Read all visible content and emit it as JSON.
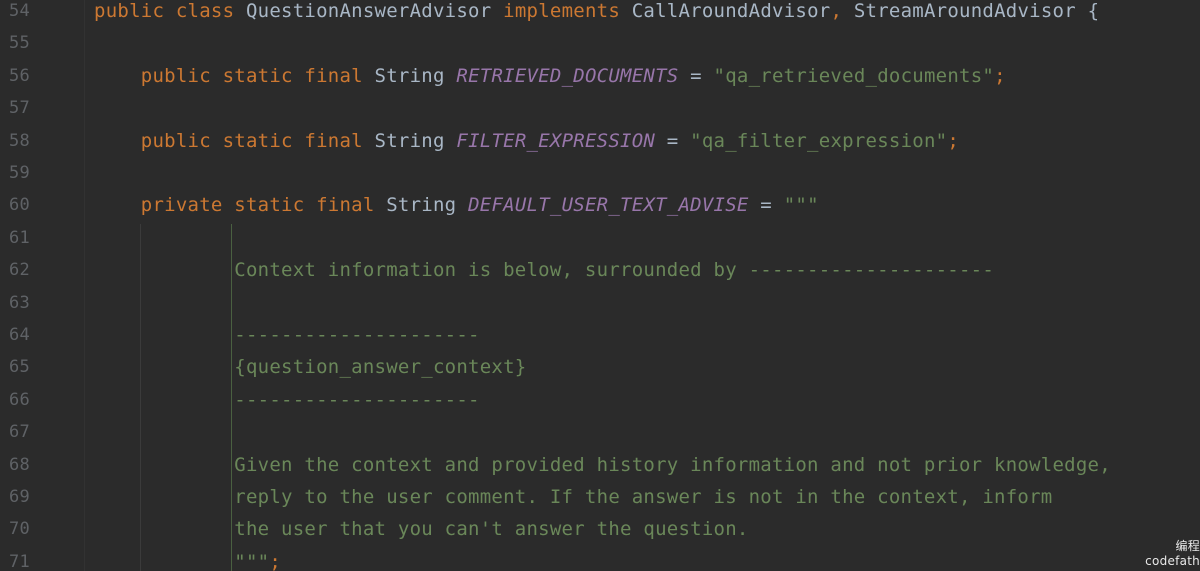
{
  "editor": {
    "lines": [
      {
        "num": "54",
        "tokens": [
          {
            "t": "kw",
            "v": "public class "
          },
          {
            "t": "plain",
            "v": "QuestionAnswerAdvisor "
          },
          {
            "t": "kw",
            "v": "implements "
          },
          {
            "t": "plain",
            "v": "CallAroundAdvisor"
          },
          {
            "t": "punc",
            "v": ", "
          },
          {
            "t": "plain",
            "v": "StreamAroundAdvisor {"
          }
        ]
      },
      {
        "num": "55",
        "tokens": []
      },
      {
        "num": "56",
        "tokens": [
          {
            "t": "kw",
            "v": "    public static final "
          },
          {
            "t": "type",
            "v": "String "
          },
          {
            "t": "const",
            "v": "RETRIEVED_DOCUMENTS"
          },
          {
            "t": "plain",
            "v": " = "
          },
          {
            "t": "str",
            "v": "\"qa_retrieved_documents\""
          },
          {
            "t": "punc",
            "v": ";"
          }
        ]
      },
      {
        "num": "57",
        "tokens": []
      },
      {
        "num": "58",
        "tokens": [
          {
            "t": "kw",
            "v": "    public static final "
          },
          {
            "t": "type",
            "v": "String "
          },
          {
            "t": "const",
            "v": "FILTER_EXPRESSION"
          },
          {
            "t": "plain",
            "v": " = "
          },
          {
            "t": "str",
            "v": "\"qa_filter_expression\""
          },
          {
            "t": "punc",
            "v": ";"
          }
        ]
      },
      {
        "num": "59",
        "tokens": []
      },
      {
        "num": "60",
        "tokens": [
          {
            "t": "kw",
            "v": "    private static final "
          },
          {
            "t": "type",
            "v": "String "
          },
          {
            "t": "const",
            "v": "DEFAULT_USER_TEXT_ADVISE"
          },
          {
            "t": "plain",
            "v": " = "
          },
          {
            "t": "str",
            "v": "\"\"\""
          }
        ]
      },
      {
        "num": "61",
        "tokens": []
      },
      {
        "num": "62",
        "tokens": [
          {
            "t": "str",
            "v": "            Context information is below, surrounded by ---------------------"
          }
        ]
      },
      {
        "num": "63",
        "tokens": []
      },
      {
        "num": "64",
        "tokens": [
          {
            "t": "str",
            "v": "            ---------------------"
          }
        ]
      },
      {
        "num": "65",
        "tokens": [
          {
            "t": "str",
            "v": "            {question_answer_context}"
          }
        ]
      },
      {
        "num": "66",
        "tokens": [
          {
            "t": "str",
            "v": "            ---------------------"
          }
        ]
      },
      {
        "num": "67",
        "tokens": []
      },
      {
        "num": "68",
        "tokens": [
          {
            "t": "str",
            "v": "            Given the context and provided history information and not prior knowledge,"
          }
        ]
      },
      {
        "num": "69",
        "tokens": [
          {
            "t": "str",
            "v": "            reply to the user comment. If the answer is not in the context, inform"
          }
        ]
      },
      {
        "num": "70",
        "tokens": [
          {
            "t": "str",
            "v": "            the user that you can't answer the question."
          }
        ]
      },
      {
        "num": "71",
        "tokens": [
          {
            "t": "str",
            "v": "            \"\"\""
          },
          {
            "t": "punc",
            "v": ";"
          }
        ]
      }
    ]
  },
  "watermark": {
    "line1": "编程",
    "line2": "codefath"
  },
  "colors": {
    "background": "#2b2b2b",
    "keyword": "#cc7832",
    "constant": "#9876aa",
    "string": "#6a8759",
    "plain": "#a9b7c6",
    "line_number": "#5f6266"
  }
}
